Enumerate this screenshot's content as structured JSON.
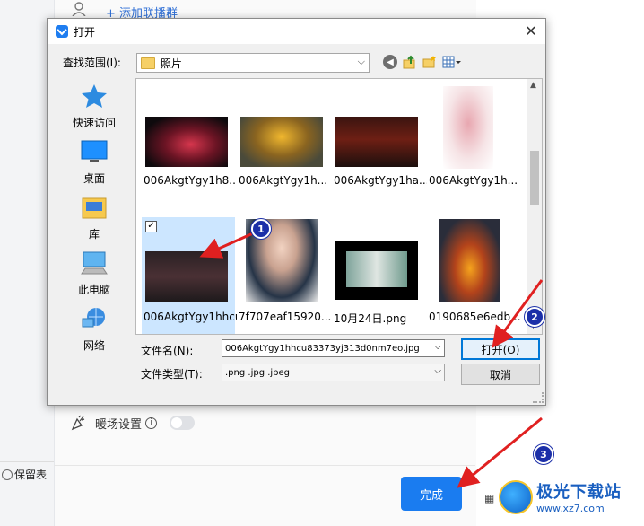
{
  "background": {
    "add_group": "+ 添加联播群",
    "warm_setting": "暖场设置",
    "keep_label": "保留表",
    "done_button": "完成",
    "watermark_cn": "极光下载站",
    "watermark_en": "www.xz7.com"
  },
  "dialog": {
    "title": "打开",
    "close": "✕",
    "look_in_label": "查找范围(I):",
    "look_in_value": "照片",
    "places": [
      {
        "label": "快速访问",
        "icon": "star-icon"
      },
      {
        "label": "桌面",
        "icon": "desktop-icon"
      },
      {
        "label": "库",
        "icon": "library-icon"
      },
      {
        "label": "此电脑",
        "icon": "computer-icon"
      },
      {
        "label": "网络",
        "icon": "network-icon"
      }
    ],
    "files": [
      {
        "name": "006AkgtYgy1h8..."
      },
      {
        "name": "006AkgtYgy1h..."
      },
      {
        "name": "006AkgtYgy1ha..."
      },
      {
        "name": "006AkgtYgy1h..."
      },
      {
        "name": "006AkgtYgy1hhcu83373yj313d0n",
        "selected": true
      },
      {
        "name": "7f707eaf15920..."
      },
      {
        "name": "10月24日.png"
      },
      {
        "name": "0190685e6edb..."
      }
    ],
    "file_name_label": "文件名(N):",
    "file_name_value": "006AkgtYgy1hhcu83373yj313d0nm7eo.jpg",
    "file_type_label": "文件类型(T):",
    "file_type_value": ".png .jpg .jpeg",
    "open_button": "打开(O)",
    "cancel_button": "取消"
  },
  "annotations": [
    "1",
    "2",
    "3"
  ],
  "colors": {
    "accent": "#1a7cf0",
    "badge": "#1b2fa8",
    "arrow": "#e02020",
    "selection": "#cce6ff"
  }
}
